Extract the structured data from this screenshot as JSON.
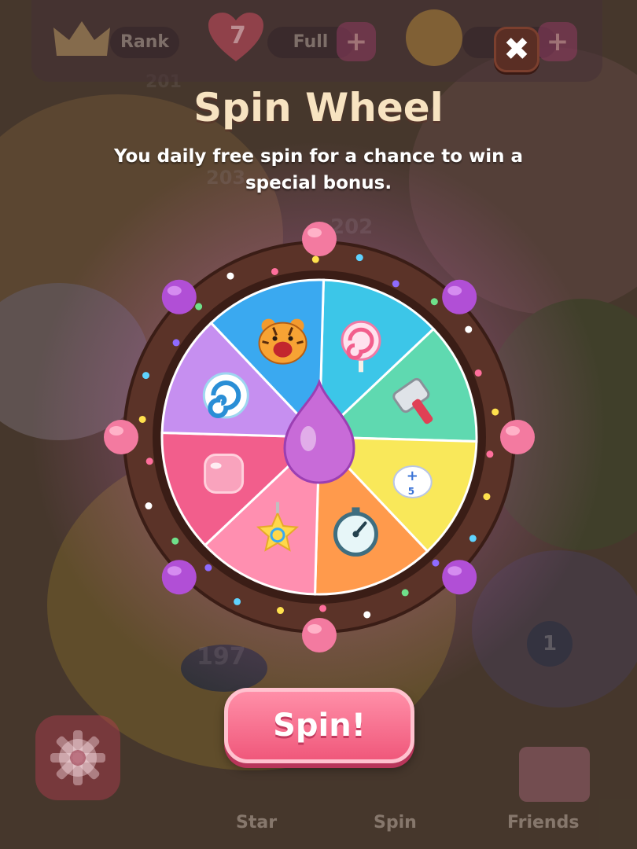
{
  "top_bar": {
    "rank_label": "Rank",
    "lives_count": "7",
    "lives_status": "Full",
    "plus_symbol": "+",
    "close_symbol": "✖"
  },
  "dialog": {
    "title": "Spin Wheel",
    "subtitle": "You daily free spin for a chance to win a special bonus.",
    "spin_button": "Spin!"
  },
  "wheel": {
    "segments": [
      {
        "icon": "lollipop-icon",
        "color": "#3cc6e8"
      },
      {
        "icon": "hammer-icon",
        "color": "#5fd9b0"
      },
      {
        "icon": "extra-moves-glove-icon",
        "color": "#f9e85a"
      },
      {
        "icon": "stopwatch-icon",
        "color": "#ff9a4c"
      },
      {
        "icon": "star-shuffle-icon",
        "color": "#ff8fb0"
      },
      {
        "icon": "bubble-icon",
        "color": "#f25e8c"
      },
      {
        "icon": "swirl-candy-icon",
        "color": "#c68ff0"
      },
      {
        "icon": "tiger-icon",
        "color": "#3aa9f0"
      }
    ],
    "rim_color": "#5b3328",
    "pointer_color": "#c86bd8"
  },
  "background": {
    "level_numbers": [
      "201",
      "203",
      "202",
      "197",
      "1"
    ]
  },
  "bottom_nav": {
    "star_label": "Star",
    "spin_label": "Spin",
    "friends_label": "Friends"
  }
}
